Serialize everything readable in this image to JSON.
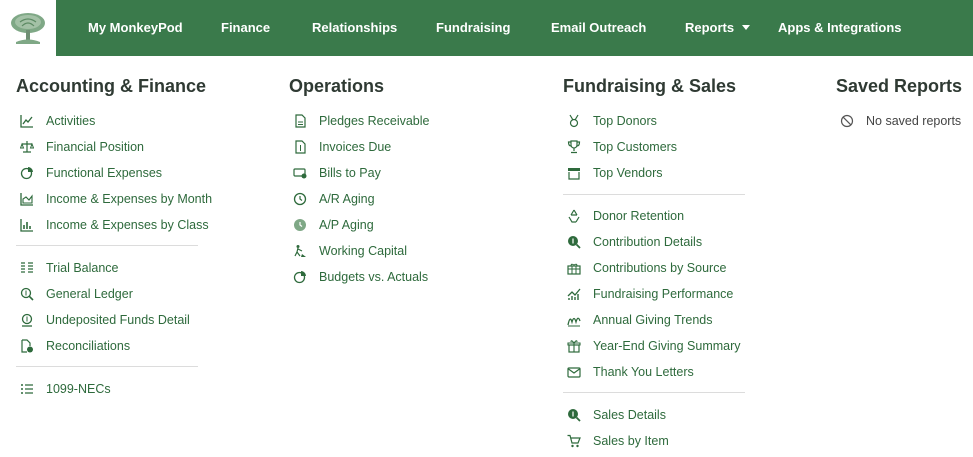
{
  "nav": {
    "items": [
      {
        "label": "My MonkeyPod"
      },
      {
        "label": "Finance"
      },
      {
        "label": "Relationships"
      },
      {
        "label": "Fundraising"
      },
      {
        "label": "Email Outreach"
      },
      {
        "label": "Reports"
      },
      {
        "label": "Apps & Integrations"
      }
    ]
  },
  "columns": [
    {
      "heading": "Accounting & Finance",
      "items": [
        {
          "label": "Activities",
          "icon": "line-chart-icon"
        },
        {
          "label": "Financial Position",
          "icon": "scale-icon"
        },
        {
          "label": "Functional Expenses",
          "icon": "pie-chart-icon"
        },
        {
          "label": "Income & Expenses by Month",
          "icon": "area-chart-icon"
        },
        {
          "label": "Income & Expenses by Class",
          "icon": "bar-chart-icon"
        },
        {
          "label": "Trial Balance",
          "icon": "list-columns-icon"
        },
        {
          "label": "General Ledger",
          "icon": "search-dollar-icon"
        },
        {
          "label": "Undeposited Funds Detail",
          "icon": "money-bag-icon"
        },
        {
          "label": "Reconciliations",
          "icon": "file-check-icon"
        },
        {
          "label": "1099-NECs",
          "icon": "list-icon"
        }
      ]
    },
    {
      "heading": "Operations",
      "items": [
        {
          "label": "Pledges Receivable",
          "icon": "invoice-icon"
        },
        {
          "label": "Invoices Due",
          "icon": "invoice-dollar-icon"
        },
        {
          "label": "Bills to Pay",
          "icon": "money-check-icon"
        },
        {
          "label": "A/R Aging",
          "icon": "clock-icon"
        },
        {
          "label": "A/P Aging",
          "icon": "clock-solid-icon"
        },
        {
          "label": "Working Capital",
          "icon": "person-digging-icon"
        },
        {
          "label": "Budgets vs. Actuals",
          "icon": "pie-chart-icon"
        }
      ]
    },
    {
      "heading": "Fundraising & Sales",
      "items": [
        {
          "label": "Top Donors",
          "icon": "medal-icon"
        },
        {
          "label": "Top Customers",
          "icon": "trophy-icon"
        },
        {
          "label": "Top Vendors",
          "icon": "store-icon"
        },
        {
          "label": "Donor Retention",
          "icon": "recycle-icon"
        },
        {
          "label": "Contribution Details",
          "icon": "search-dollar-icon"
        },
        {
          "label": "Contributions by Source",
          "icon": "gift-box-icon"
        },
        {
          "label": "Fundraising Performance",
          "icon": "trend-up-icon"
        },
        {
          "label": "Annual Giving Trends",
          "icon": "chart-wave-icon"
        },
        {
          "label": "Year-End Giving Summary",
          "icon": "gift-icon"
        },
        {
          "label": "Thank You Letters",
          "icon": "envelope-icon"
        },
        {
          "label": "Sales Details",
          "icon": "search-dollar-icon"
        },
        {
          "label": "Sales by Item",
          "icon": "cart-icon"
        }
      ]
    },
    {
      "heading": "Saved Reports",
      "empty_label": "No saved reports",
      "empty_icon": "ban-icon"
    }
  ]
}
